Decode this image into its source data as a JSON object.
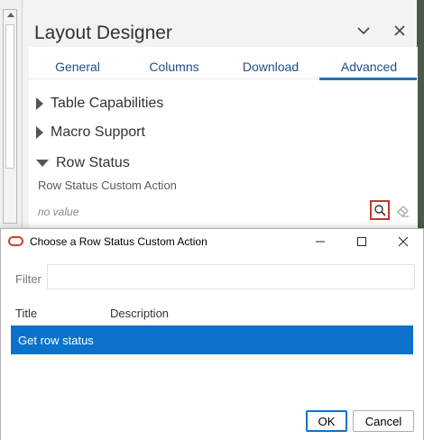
{
  "designer": {
    "title": "Layout Designer",
    "tabs": [
      {
        "label": "General"
      },
      {
        "label": "Columns"
      },
      {
        "label": "Download"
      },
      {
        "label": "Advanced"
      }
    ],
    "active_tab": "Advanced",
    "sections": {
      "table_capabilities": "Table Capabilities",
      "macro_support": "Macro Support",
      "row_status": "Row Status"
    },
    "field": {
      "label": "Row Status Custom Action",
      "value": "no value"
    },
    "icons": {
      "collapse": "chevron-down-icon",
      "close": "close-icon",
      "search": "search-icon",
      "clear": "eraser-icon"
    }
  },
  "dialog": {
    "title": "Choose a Row Status Custom Action",
    "filter_label": "Filter",
    "filter_value": "",
    "columns": {
      "title": "Title",
      "description": "Description"
    },
    "rows": [
      {
        "title": "Get row status",
        "description": "",
        "selected": true
      }
    ],
    "ok_label": "OK",
    "cancel_label": "Cancel",
    "colors": {
      "selection": "#0c72c9",
      "accent": "#c74634"
    }
  }
}
